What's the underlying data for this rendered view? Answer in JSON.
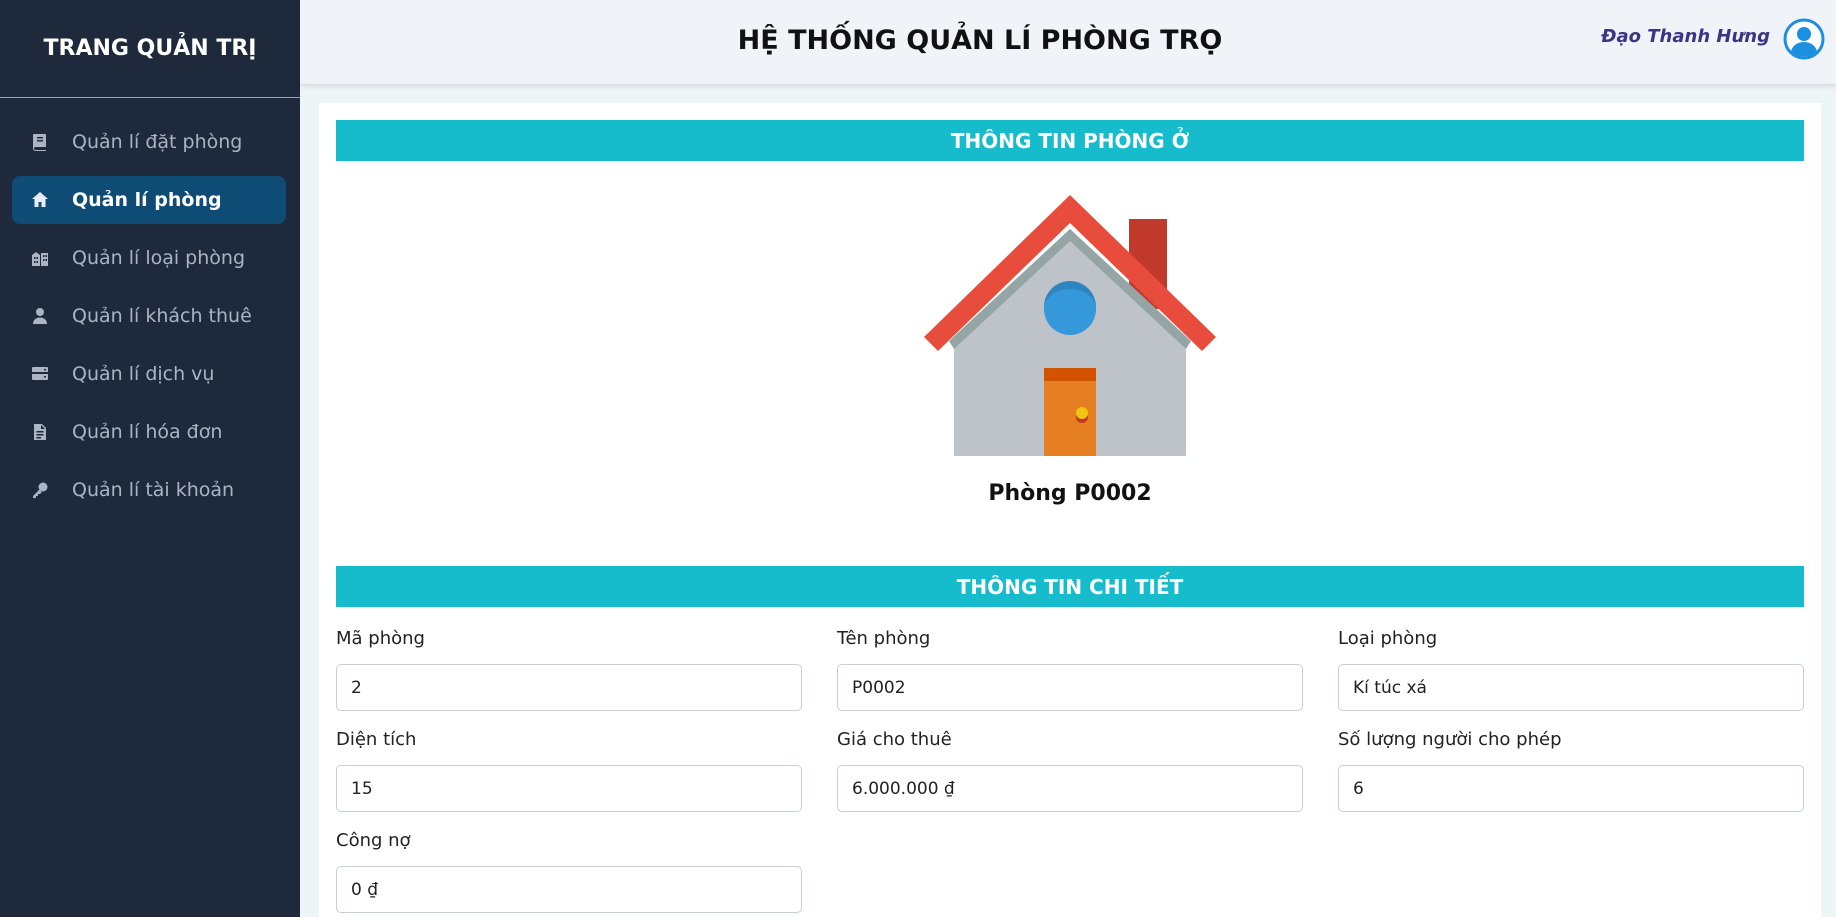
{
  "sidebar": {
    "title": "TRANG QUẢN TRỊ",
    "items": [
      {
        "label": "Quản lí đặt phòng",
        "icon": "book-icon"
      },
      {
        "label": "Quản lí phòng",
        "icon": "home-icon",
        "active": true
      },
      {
        "label": "Quản lí loại phòng",
        "icon": "building-icon"
      },
      {
        "label": "Quản lí khách thuê",
        "icon": "user-icon"
      },
      {
        "label": "Quản lí dịch vụ",
        "icon": "server-icon"
      },
      {
        "label": "Quản lí hóa đơn",
        "icon": "invoice-icon"
      },
      {
        "label": "Quản lí tài khoản",
        "icon": "key-icon"
      }
    ]
  },
  "header": {
    "title": "HỆ THỐNG QUẢN LÍ PHÒNG TRỌ",
    "user_name": "Đạo Thanh Hưng"
  },
  "room_section": {
    "title": "THÔNG TIN PHÒNG Ở",
    "room_name": "Phòng P0002"
  },
  "detail_section": {
    "title": "THÔNG TIN CHI TIẾT",
    "fields": {
      "ma_phong": {
        "label": "Mã phòng",
        "value": "2"
      },
      "ten_phong": {
        "label": "Tên phòng",
        "value": "P0002"
      },
      "loai_phong": {
        "label": "Loại phòng",
        "value": "Kí túc xá"
      },
      "dien_tich": {
        "label": "Diện tích",
        "value": "15"
      },
      "gia_thue": {
        "label": "Giá cho thuê",
        "value": "6.000.000 ₫"
      },
      "so_nguoi": {
        "label": "Số lượng người cho phép",
        "value": "6"
      },
      "cong_no": {
        "label": "Công nợ",
        "value": "0 ₫"
      }
    }
  },
  "colors": {
    "sidebar_bg": "#1e293b",
    "active_item": "#0f4c75",
    "section_bar": "#17bccc",
    "user_name": "#3a3585",
    "avatar": "#1b8fe0"
  }
}
